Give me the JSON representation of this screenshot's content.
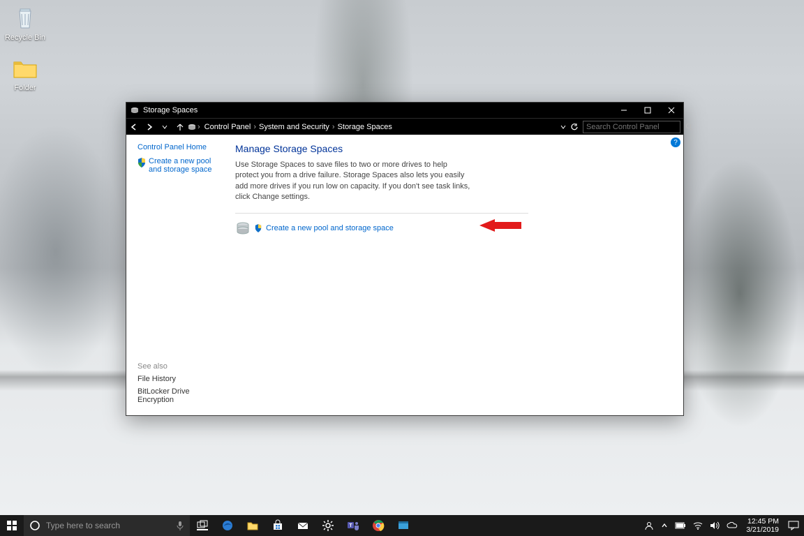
{
  "desktop_icons": {
    "recycle_bin": "Recycle Bin",
    "folder": "Folder"
  },
  "window": {
    "title": "Storage Spaces",
    "breadcrumb": [
      "Control Panel",
      "System and Security",
      "Storage Spaces"
    ],
    "search_placeholder": "Search Control Panel"
  },
  "leftnav": {
    "home": "Control Panel Home",
    "create_link": "Create a new pool and storage space",
    "see_also_label": "See also",
    "see_also": [
      "File History",
      "BitLocker Drive Encryption"
    ]
  },
  "main": {
    "heading": "Manage Storage Spaces",
    "description": "Use Storage Spaces to save files to two or more drives to help protect you from a drive failure. Storage Spaces also lets you easily add more drives if you run low on capacity. If you don't see task links, click Change settings.",
    "action_link": "Create a new pool and storage space"
  },
  "taskbar": {
    "search_placeholder": "Type here to search",
    "clock_time": "12:45 PM",
    "clock_date": "3/21/2019"
  }
}
